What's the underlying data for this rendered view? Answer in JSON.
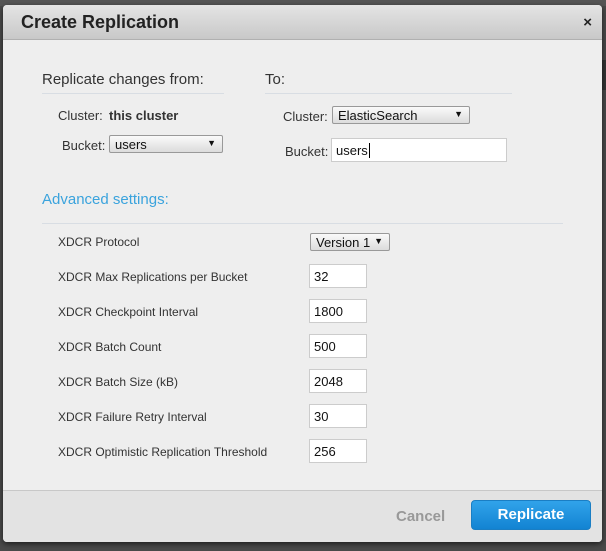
{
  "dialog": {
    "title": "Create Replication",
    "close_icon": "×"
  },
  "source": {
    "heading": "Replicate changes from:",
    "cluster_label": "Cluster:",
    "cluster_value": "this cluster",
    "bucket_label": "Bucket:",
    "bucket_selected": "users"
  },
  "target": {
    "heading": "To:",
    "cluster_label": "Cluster:",
    "cluster_selected": "ElasticSearch",
    "bucket_label": "Bucket:",
    "bucket_value": "users"
  },
  "advanced": {
    "heading": "Advanced settings:",
    "protocol_label": "XDCR Protocol",
    "protocol_selected": "Version 1",
    "settings": [
      {
        "label": "XDCR Max Replications per Bucket",
        "value": "32"
      },
      {
        "label": "XDCR Checkpoint Interval",
        "value": "1800"
      },
      {
        "label": "XDCR Batch Count",
        "value": "500"
      },
      {
        "label": "XDCR Batch Size (kB)",
        "value": "2048"
      },
      {
        "label": "XDCR Failure Retry Interval",
        "value": "30"
      },
      {
        "label": "XDCR Optimistic Replication Threshold",
        "value": "256"
      }
    ]
  },
  "footer": {
    "cancel_label": "Cancel",
    "replicate_label": "Replicate"
  },
  "icons": {
    "dropdown_arrow": "▼",
    "close": "close-icon"
  },
  "colors": {
    "accent": "#3aa3dd",
    "primary_button": "#1a8ad6"
  }
}
